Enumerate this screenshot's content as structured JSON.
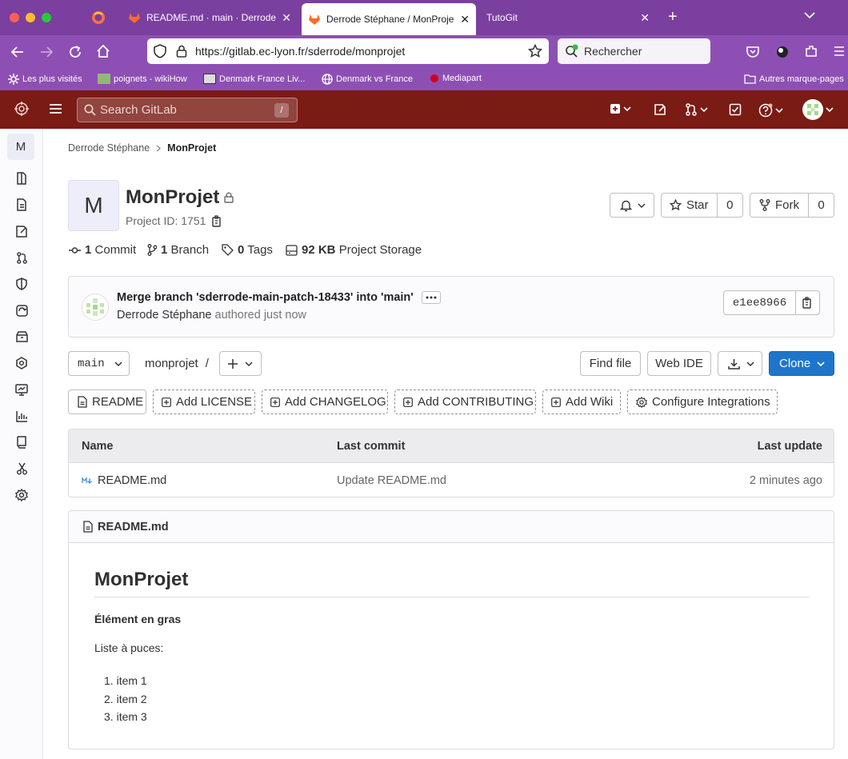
{
  "browser": {
    "tabs": [
      {
        "label": ""
      },
      {
        "label": "README.md · main · Derrode Stéphane"
      },
      {
        "label": "Derrode Stéphane / MonProjet · GitLab"
      },
      {
        "label": "TutoGit"
      }
    ],
    "url_prefix": "https://",
    "url_host": "gitlab.ec-lyon.fr",
    "url_path": "/sderrode/monprojet",
    "search_placeholder": "Rechercher",
    "bookmarks": [
      "Les plus visités",
      "poignets - wikiHow",
      "Denmark France Liv...",
      "Denmark vs France",
      "Mediapart",
      "Autres marque-pages"
    ]
  },
  "gitlab_header": {
    "search_placeholder": "Search GitLab",
    "search_shortcut": "/"
  },
  "sidebar": {
    "project_letter": "M"
  },
  "breadcrumb": {
    "parent": "Derrode Stéphane",
    "current": "MonProjet"
  },
  "project": {
    "avatar_letter": "M",
    "name": "MonProjet",
    "id_label": "Project ID: 1751",
    "star_label": "Star",
    "star_count": "0",
    "fork_label": "Fork",
    "fork_count": "0"
  },
  "stats": {
    "commits_count": "1",
    "commits_label": "Commit",
    "branches_count": "1",
    "branches_label": "Branch",
    "tags_count": "0",
    "tags_label": "Tags",
    "storage_value": "92 KB",
    "storage_label": "Project Storage"
  },
  "last_commit": {
    "message": "Merge branch 'sderrode-main-patch-18433' into 'main'",
    "author": "Derrode Stéphane",
    "authored": "authored",
    "when": "just now",
    "sha": "e1ee8966"
  },
  "repo_toolbar": {
    "branch": "main",
    "path": "monprojet",
    "path_sep": "/",
    "find_file": "Find file",
    "web_ide": "Web IDE",
    "clone": "Clone"
  },
  "quick_buttons": [
    "README",
    "Add LICENSE",
    "Add CHANGELOG",
    "Add CONTRIBUTING",
    "Add Wiki",
    "Configure Integrations"
  ],
  "file_table": {
    "headers": [
      "Name",
      "Last commit",
      "Last update"
    ],
    "rows": [
      {
        "name": "README.md",
        "commit": "Update README.md",
        "updated": "2 minutes ago"
      }
    ]
  },
  "readme": {
    "filename": "README.md",
    "title": "MonProjet",
    "bold_text": "Élément en gras",
    "list_intro": "Liste à puces:",
    "items": [
      "item 1",
      "item 2",
      "item 3"
    ]
  },
  "colors": {
    "gitlab_header": "#7a1b14",
    "browser_tabbar": "#7b3fa0",
    "clone_button": "#1f75cb"
  }
}
